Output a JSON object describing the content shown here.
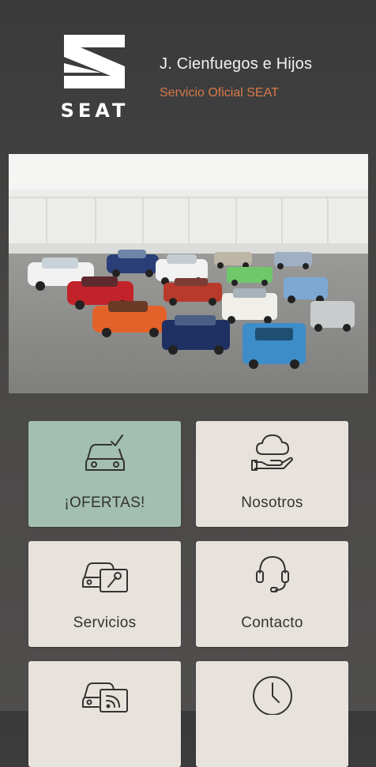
{
  "header": {
    "brand_wordmark": "SEAT",
    "dealer_name": "J. Cienfuegos e Hijos",
    "dealer_subtitle": "Servicio Oficial SEAT",
    "subtitle_color": "#d7794a"
  },
  "hero": {
    "image": "fleet-of-seat-cars-photo"
  },
  "menu": {
    "accent_color": "#a3bfb2",
    "tile_color": "#e7e2db",
    "items": [
      {
        "label": "¡OFERTAS!",
        "icon": "car-check-icon"
      },
      {
        "label": "Nosotros",
        "icon": "cloud-hand-icon"
      },
      {
        "label": "Servicios",
        "icon": "car-wrench-icon"
      },
      {
        "label": "Contacto",
        "icon": "headset-icon"
      },
      {
        "label": "",
        "icon": "car-wifi-icon"
      },
      {
        "label": "",
        "icon": "clock-icon"
      }
    ]
  }
}
